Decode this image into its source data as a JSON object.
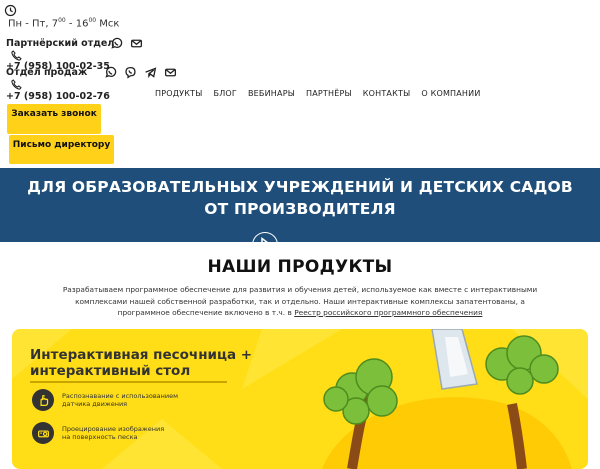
{
  "topbar": {
    "hours_prefix": "Пн - Пт, 7",
    "hours_open_sup": "00",
    "hours_mid": " - 16",
    "hours_close_sup": "00",
    "hours_suffix": " Мск",
    "partner_dept": "Партнёрский отдел",
    "partner_phone": "+7 (958) 100-02-35",
    "sales_dept": "Отдел продаж",
    "sales_phone": "+7 (958) 100-02-76"
  },
  "nav": {
    "items": [
      "ПРОДУКТЫ",
      "БЛОГ",
      "ВЕБИНАРЫ",
      "ПАРТНЁРЫ",
      "КОНТАКТЫ",
      "О КОМПАНИИ"
    ]
  },
  "buttons": {
    "call_label": "Заказать звонок",
    "director_label": "Письмо директору"
  },
  "hero": {
    "line1": "ДЛЯ ОБРАЗОВАТЕЛЬНЫХ УЧРЕЖДЕНИЙ И ДЕТСКИХ САДОВ",
    "line2": "ОТ ПРОИЗВОДИТЕЛЯ"
  },
  "products": {
    "title": "НАШИ ПРОДУКТЫ",
    "desc_line1": "Разрабатываем программное обеспечение для развития и обучения детей, используемое как вместе с интерактивными",
    "desc_line2": "комплексами нашей собственной разработки, так и отдельно. Наши интерактивные комплексы запатентованы, а",
    "desc_line3": "программное обеспечение включено в т.ч. в ",
    "registry_link": "Реестр российского программного обеспечения"
  },
  "card": {
    "title_line1": "Интерактивная песочница +",
    "title_line2": "интерактивный стол",
    "features": [
      {
        "line1": "Распознавание с использованием",
        "line2": "датчика движения"
      },
      {
        "line1": "Проецирование изображения",
        "line2": "на поверхность песка"
      }
    ]
  },
  "colors": {
    "accent_yellow": "#ffd119",
    "card_yellow": "#ffde17",
    "hero_blue": "#1e4e79"
  },
  "icons": [
    "clock-icon",
    "whatsapp-icon",
    "email-icon",
    "phone-icon",
    "viber-icon",
    "telegram-icon",
    "hand-icon",
    "projector-icon"
  ]
}
